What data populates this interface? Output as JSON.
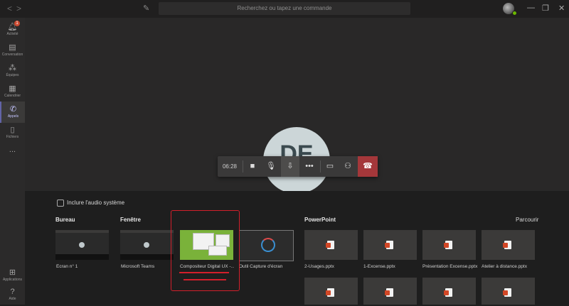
{
  "titlebar": {
    "search_placeholder": "Recherchez ou tapez une commande",
    "back": "<",
    "forward": ">"
  },
  "appbar": {
    "items": [
      {
        "label": "Activité",
        "icon": "bell-icon",
        "badge": "1"
      },
      {
        "label": "Conversation",
        "icon": "chat-icon"
      },
      {
        "label": "Équipes",
        "icon": "teams-icon"
      },
      {
        "label": "Calendrier",
        "icon": "calendar-icon"
      },
      {
        "label": "Appels",
        "icon": "phone-icon",
        "active": true
      },
      {
        "label": "Fichiers",
        "icon": "file-icon"
      },
      {
        "label": "...",
        "icon": "more-icon"
      }
    ],
    "bottom": [
      {
        "label": "Applications",
        "icon": "apps-icon"
      },
      {
        "label": "Aide",
        "icon": "help-icon"
      }
    ]
  },
  "call": {
    "avatar_initials": "DE",
    "timer": "06:28"
  },
  "share": {
    "include_audio_label": "Inclure l'audio système",
    "desktop_title": "Bureau",
    "window_title": "Fenêtre",
    "powerpoint_title": "PowerPoint",
    "browse_label": "Parcourir",
    "desktop": [
      {
        "label": "Écran n° 1"
      }
    ],
    "windows": [
      {
        "label": "Microsoft Teams"
      },
      {
        "label": "Compositeur Digital UX -..."
      },
      {
        "label": "Outil Capture d'écran"
      }
    ],
    "powerpoint": [
      {
        "label": "2-Usages.pptx"
      },
      {
        "label": "1-Excense.pptx"
      },
      {
        "label": "Présentation Excense.pptx"
      },
      {
        "label": "Atelier à distance.pptx"
      }
    ]
  },
  "colors": {
    "accent": "#6264a7",
    "hangup": "#a4373a",
    "annotation": "#d21f2b"
  }
}
